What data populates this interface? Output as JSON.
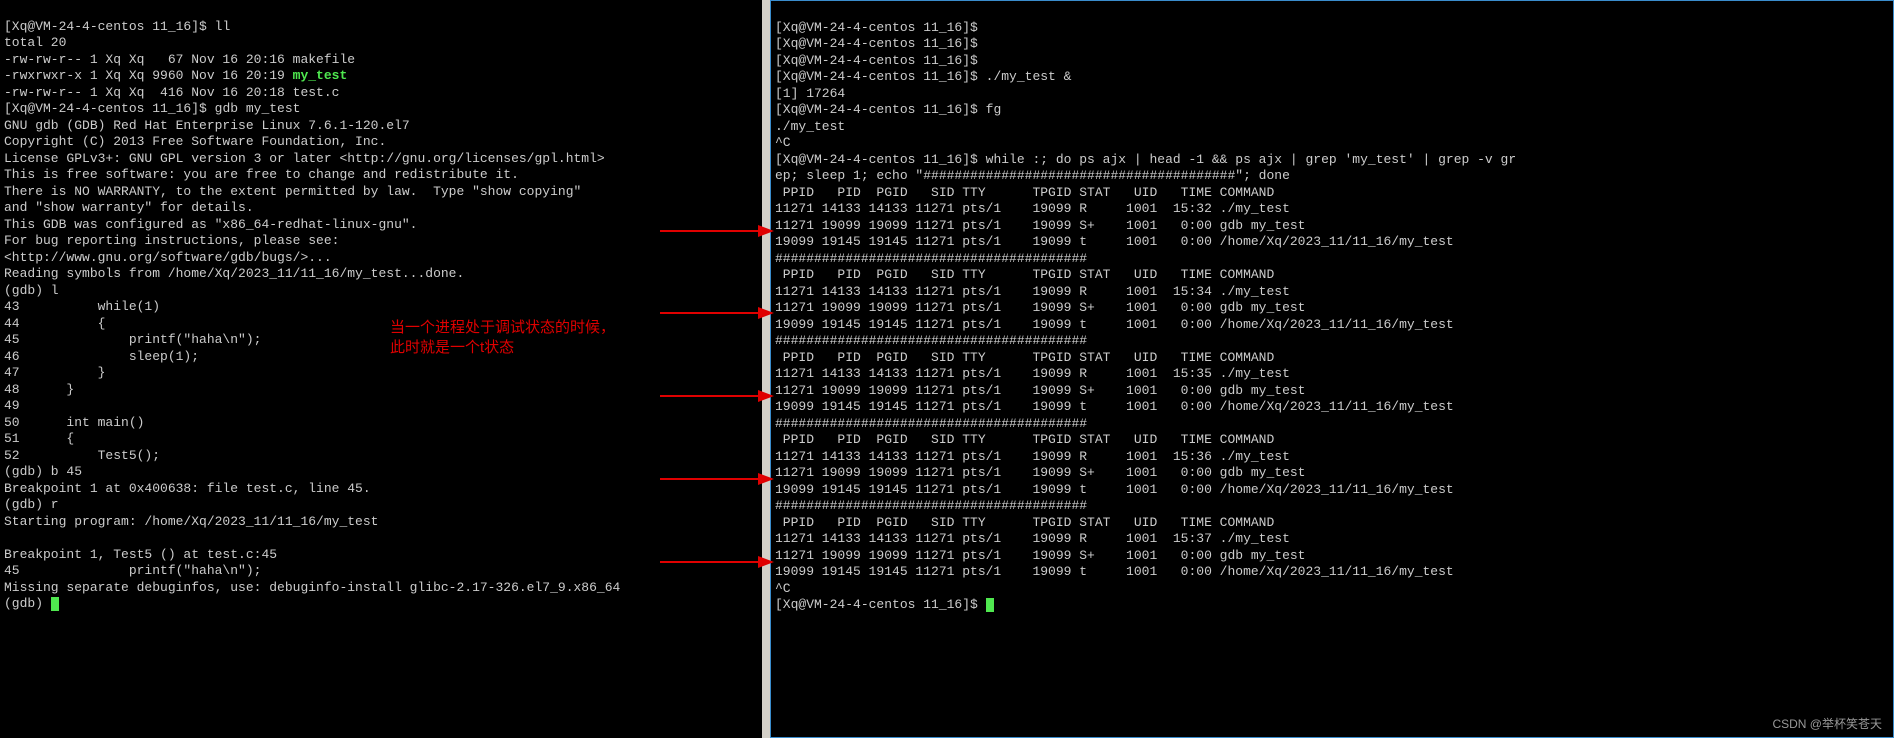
{
  "left": {
    "prompt": "[Xq@VM-24-4-centos 11_16]$ ",
    "cmd_ll": "ll",
    "ll_out": "total 20\n-rw-rw-r-- 1 Xq Xq   67 Nov 16 20:16 makefile",
    "ll_exec_perm": "-rwxrwxr-x 1 Xq Xq 9960 Nov 16 20:19 ",
    "ll_exec_name": "my_test",
    "ll_testc": "-rw-rw-r-- 1 Xq Xq  416 Nov 16 20:18 test.c",
    "cmd_gdb": "gdb my_test",
    "gdb_header": "GNU gdb (GDB) Red Hat Enterprise Linux 7.6.1-120.el7\nCopyright (C) 2013 Free Software Foundation, Inc.\nLicense GPLv3+: GNU GPL version 3 or later <http://gnu.org/licenses/gpl.html>\nThis is free software: you are free to change and redistribute it.\nThere is NO WARRANTY, to the extent permitted by law.  Type \"show copying\"\nand \"show warranty\" for details.\nThis GDB was configured as \"x86_64-redhat-linux-gnu\".\nFor bug reporting instructions, please see:\n<http://www.gnu.org/software/gdb/bugs/>...\nReading symbols from /home/Xq/2023_11/11_16/my_test...done.",
    "gdb_l": "(gdb) l",
    "code_listing": "43          while(1)\n44          {\n45              printf(\"haha\\n\");\n46              sleep(1);\n47          }\n48      }\n49\n50      int main()\n51      {\n52          Test5();",
    "gdb_b": "(gdb) b 45",
    "bp_set": "Breakpoint 1 at 0x400638: file test.c, line 45.",
    "gdb_r": "(gdb) r",
    "starting": "Starting program: /home/Xq/2023_11/11_16/my_test",
    "bp_hit": "Breakpoint 1, Test5 () at test.c:45\n45              printf(\"haha\\n\");\nMissing separate debuginfos, use: debuginfo-install glibc-2.17-326.el7_9.x86_64",
    "gdb_final": "(gdb) "
  },
  "right": {
    "prompt": "[Xq@VM-24-4-centos 11_16]$ ",
    "cmd_bg": "./my_test &",
    "job": "[1] 17264",
    "cmd_fg": "fg",
    "fg_out": "./my_test",
    "ctrlc": "^C",
    "cmd_while": "while :; do ps ajx | head -1 && ps ajx | grep 'my_test' | grep -v gr",
    "cmd_while2": "ep; sleep 1; echo \"########################################\"; done",
    "header": " PPID   PID  PGID   SID TTY      TPGID STAT   UID   TIME COMMAND",
    "row1": "11271 14133 14133 11271 pts/1    19099 R     1001  15:32 ./my_test",
    "row2": "11271 19099 19099 11271 pts/1    19099 S+    1001   0:00 gdb my_test",
    "row3": "19099 19145 19145 11271 pts/1    19099 t     1001   0:00 /home/Xq/2023_11/11_16/my_test",
    "divider": "########################################",
    "row1b": "11271 14133 14133 11271 pts/1    19099 R     1001  15:34 ./my_test",
    "row1c": "11271 14133 14133 11271 pts/1    19099 R     1001  15:35 ./my_test",
    "row1d": "11271 14133 14133 11271 pts/1    19099 R     1001  15:36 ./my_test",
    "row1e": "11271 14133 14133 11271 pts/1    19099 R     1001  15:37 ./my_test"
  },
  "annotation": {
    "line1": "当一个进程处于调试状态的时候，",
    "line2": "此时就是一个t状态"
  },
  "watermark": "CSDN @举杯笑苍天"
}
